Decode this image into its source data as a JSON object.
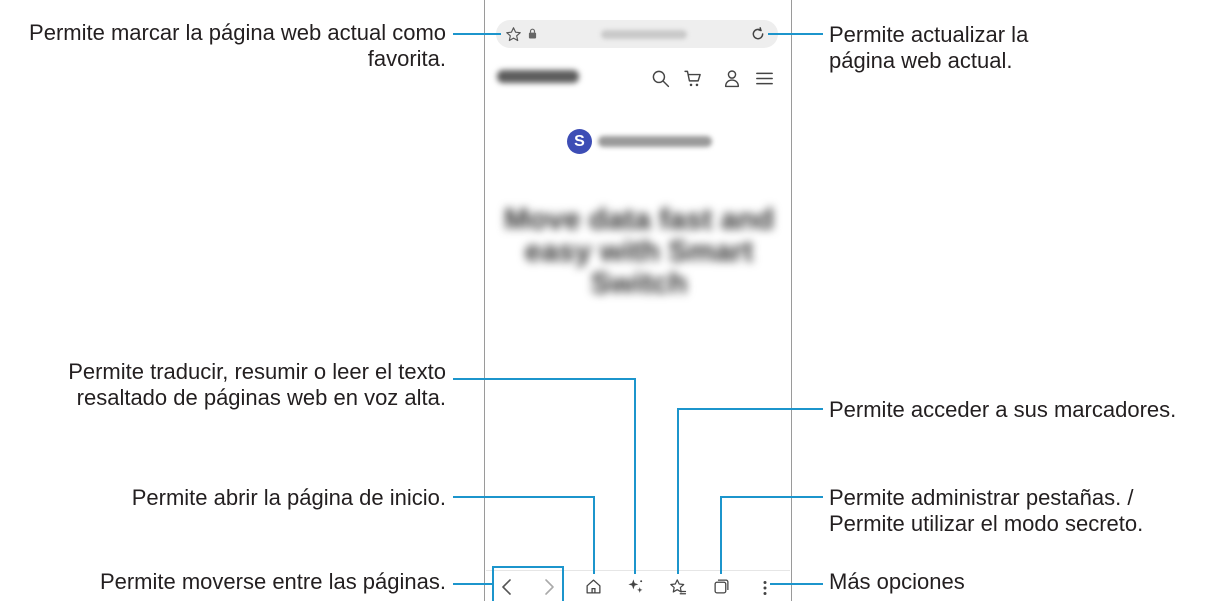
{
  "callouts": {
    "bookmark_page": "Permite marcar la página web actual como favorita.",
    "refresh": "Permite actualizar la página web actual.",
    "translate": "Permite traducir, resumir o leer el texto resaltado de páginas web en voz alta.",
    "bookmarks": "Permite acceder a sus marcadores.",
    "home": "Permite abrir la página de inicio.",
    "tabs": "Permite administrar pestañas. / Permite utilizar el modo secreto.",
    "navigate": "Permite moverse entre las páginas.",
    "more": "Más opciones"
  },
  "browser": {
    "logo_letter": "S",
    "hero_title": "Move data fast and easy with Smart Switch"
  },
  "icons": {
    "toolbar": [
      "star-icon",
      "lock-icon",
      "refresh-icon"
    ],
    "site_header": [
      "search-icon",
      "cart-icon",
      "person-icon",
      "menu-icon"
    ],
    "bottom_bar": [
      "back-icon",
      "forward-icon",
      "home-icon",
      "ai-sparkle-icon",
      "bookmarks-icon",
      "tabs-icon",
      "more-icon"
    ]
  },
  "colors": {
    "callout_line": "#1c95cc",
    "logo_badge": "#3d4db5"
  }
}
